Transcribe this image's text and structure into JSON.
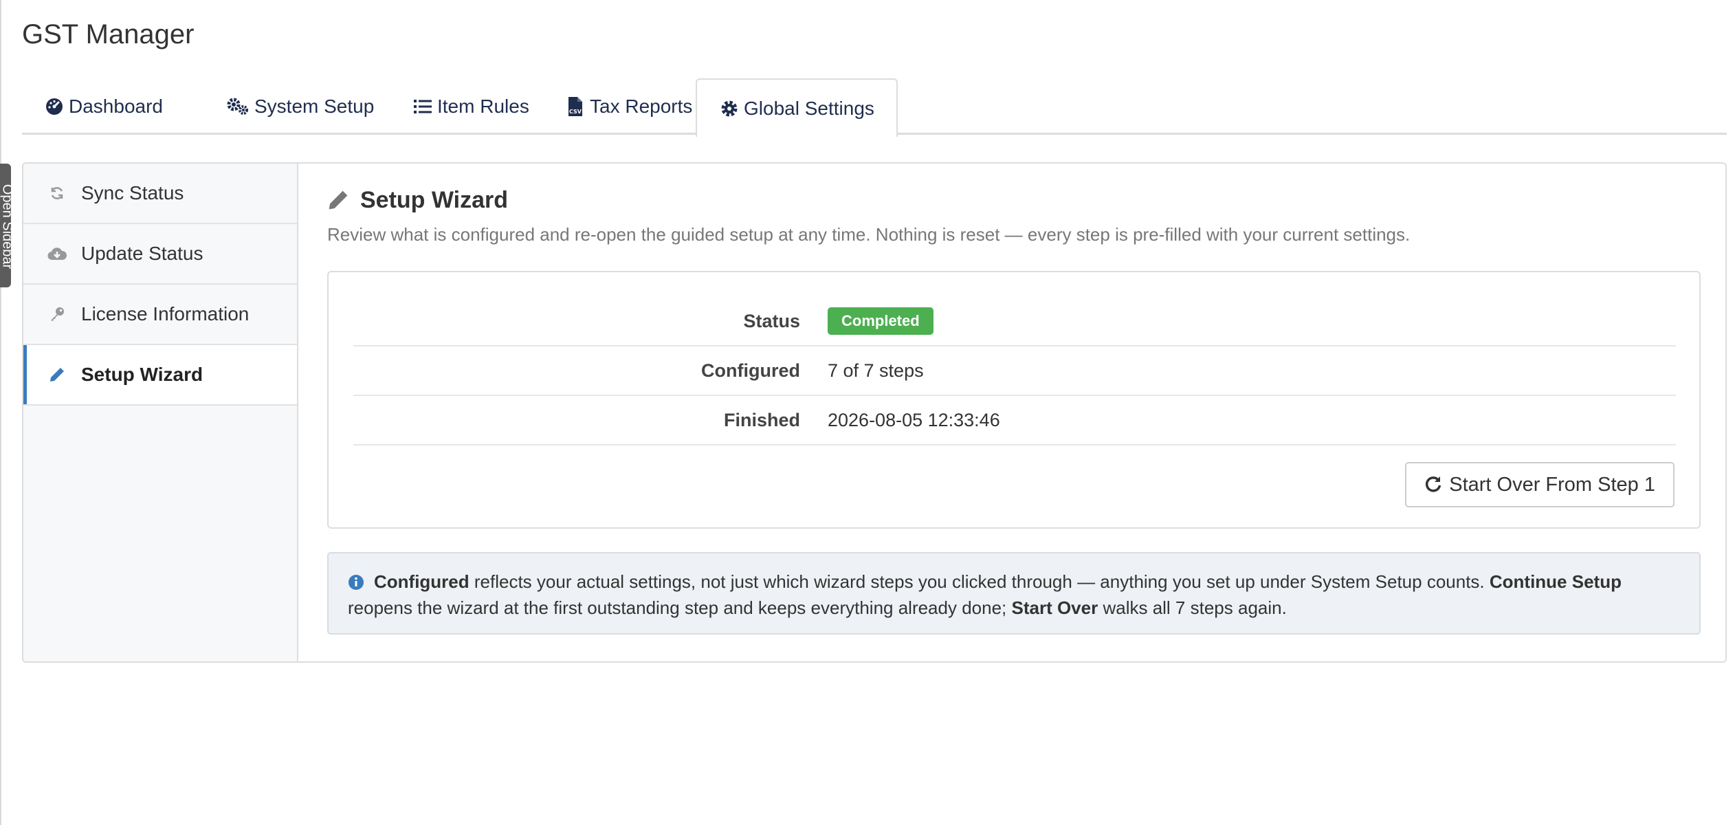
{
  "app": {
    "title": "GST Manager",
    "sidebar_toggle_label": "Open Sidebar"
  },
  "tabs": [
    {
      "label": "Dashboard",
      "icon": "dashboard-icon",
      "active": false
    },
    {
      "label": "System Setup",
      "icon": "cogs-icon",
      "active": false
    },
    {
      "label": "Item Rules",
      "icon": "list-icon",
      "active": false
    },
    {
      "label": "Tax Reports",
      "icon": "csv-file-icon",
      "active": false
    },
    {
      "label": "Global Settings",
      "icon": "gear-icon",
      "active": true
    }
  ],
  "side_menu": [
    {
      "label": "Sync Status",
      "icon": "sync-icon",
      "active": false
    },
    {
      "label": "Update Status",
      "icon": "cloud-download-icon",
      "active": false
    },
    {
      "label": "License Information",
      "icon": "key-icon",
      "active": false
    },
    {
      "label": "Setup Wizard",
      "icon": "pencil-icon",
      "active": true
    }
  ],
  "wizard": {
    "title": "Setup Wizard",
    "description": "Review what is configured and re-open the guided setup at any time. Nothing is reset — every step is pre-filled with your current settings.",
    "status_label": "Status",
    "status_value": "Completed",
    "configured_label": "Configured",
    "configured_value": "7 of 7 steps",
    "finished_label": "Finished",
    "finished_value": "2026-08-05 12:33:46",
    "start_over_label": "Start Over From Step 1"
  },
  "info": {
    "p1_bold": "Configured",
    "p1_text": " reflects your actual settings, not just which wizard steps you clicked through — anything you set up under System Setup counts. ",
    "p2_bold": "Continue Setup",
    "p2_text": " reopens the wizard at the first outstanding step and keeps everything already done; ",
    "p3_bold": "Start Over",
    "p3_text": " walks all 7 steps again."
  },
  "colors": {
    "accent": "#3a7bbd",
    "success": "#4caf50",
    "nav_text": "#1f2d4e",
    "info_bg": "#eef1f5"
  }
}
